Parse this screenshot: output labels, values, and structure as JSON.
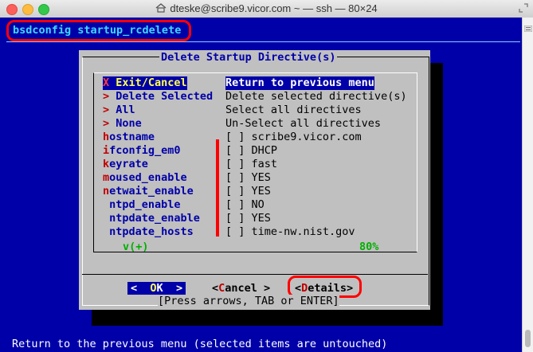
{
  "window": {
    "title": "dteske@scribe9.vicor.com ~ — ssh — 80×24"
  },
  "backtitle": "bsdconfig startup_rcdelete",
  "dialog": {
    "title": "Delete Startup Directive(s)",
    "menu": [
      {
        "hotkey": "X",
        "rest": " Exit/Cancel",
        "item": "Return to previous menu",
        "selected": true
      },
      {
        "hotkey": ">",
        "rest": " Delete Selected",
        "item": "Delete selected directive(s)"
      },
      {
        "hotkey": ">",
        "rest": " All",
        "item": "Select all directives"
      },
      {
        "hotkey": ">",
        "rest": " None",
        "item": "Un-Select all directives"
      },
      {
        "hotkey": "h",
        "rest": "ostname",
        "item": "[ ] scribe9.vicor.com"
      },
      {
        "hotkey": "i",
        "rest": "fconfig_em0",
        "item": "[ ] DHCP"
      },
      {
        "hotkey": "k",
        "rest": "eyrate",
        "item": "[ ] fast"
      },
      {
        "hotkey": "m",
        "rest": "oused_enable",
        "item": "[ ] YES"
      },
      {
        "hotkey": "n",
        "rest": "etwait_enable",
        "item": "[ ] YES"
      },
      {
        "hotkey": "",
        "rest": " ntpd_enable",
        "item": "[ ] NO"
      },
      {
        "hotkey": "",
        "rest": " ntpdate_enable",
        "item": "[ ] YES"
      },
      {
        "hotkey": "",
        "rest": " ntpdate_hosts",
        "item": "[ ] time-nw.nist.gov"
      }
    ],
    "scroll_indicator": "v(+)",
    "scroll_percent": "80%",
    "buttons": {
      "ok_left": "<",
      "ok_hotkey": "O",
      "ok_rest": "K",
      "ok_right": ">",
      "cancel_left": "<",
      "cancel_hotkey": "C",
      "cancel_rest": "ancel >",
      "details_left": "<",
      "details_hotkey": "D",
      "details_rest": "etails>"
    },
    "hint": "[Press arrows, TAB or ENTER]"
  },
  "status_line": "Return to the previous menu (selected items are untouched)",
  "colors": {
    "terminal_bg": "#0000a8",
    "dialog_bg": "#c0c0c0",
    "highlight": "#ff0000"
  }
}
